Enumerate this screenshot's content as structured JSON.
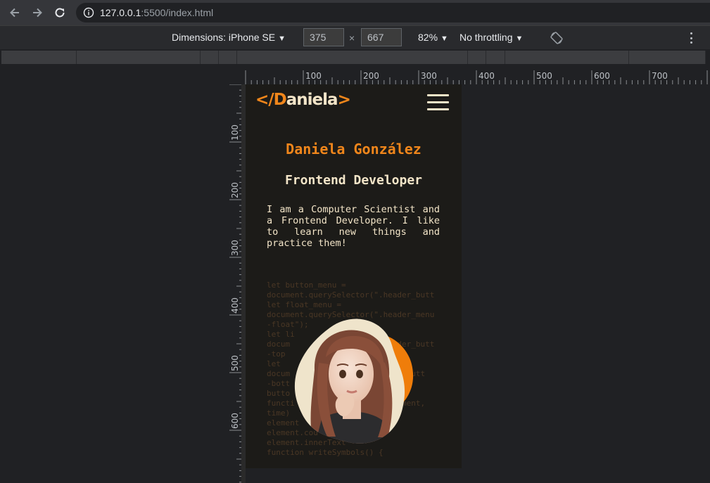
{
  "browser": {
    "url_host": "127.0.0.1",
    "url_rest": ":5500/index.html",
    "icons": [
      "back-arrow-icon",
      "forward-arrow-icon",
      "reload-icon",
      "info-icon"
    ]
  },
  "device_toolbar": {
    "dimensions_label": "Dimensions: iPhone SE",
    "width": "375",
    "height": "667",
    "times": "×",
    "zoom": "82%",
    "throttling": "No throttling",
    "caret": "▼"
  },
  "rulers": {
    "horizontal": [
      "100",
      "200",
      "300",
      "400",
      "500",
      "600",
      "700"
    ],
    "vertical": [
      "100",
      "200",
      "300",
      "400",
      "500",
      "600"
    ]
  },
  "site": {
    "logo_open": "</",
    "logo_initial": "D",
    "logo_rest": "aniela",
    "logo_close": ">",
    "name": "Daniela González",
    "role": "Frontend Developer",
    "bio": "I am a Computer Scientist and a Frontend Developer. I like to learn new things and practice them!",
    "code_background": "let button_menu =\ndocument.querySelector(\".header_butt\nlet float_menu =\ndocument.querySelector(\".header_menu\n-float\");\nlet li\ndocum                   .header_butt\n-top\nlet\ndocum                        _butt\n-bott\nbutto\nfuncti                      ement,\ntime)\nelement\nelement.cou\nelement.innerText\nfunction writeSymbols() {"
  },
  "colors": {
    "accent": "#f0861b",
    "cream": "#f3e5c8",
    "site_bg": "#1c1b18",
    "devtools_bg": "#202124"
  }
}
